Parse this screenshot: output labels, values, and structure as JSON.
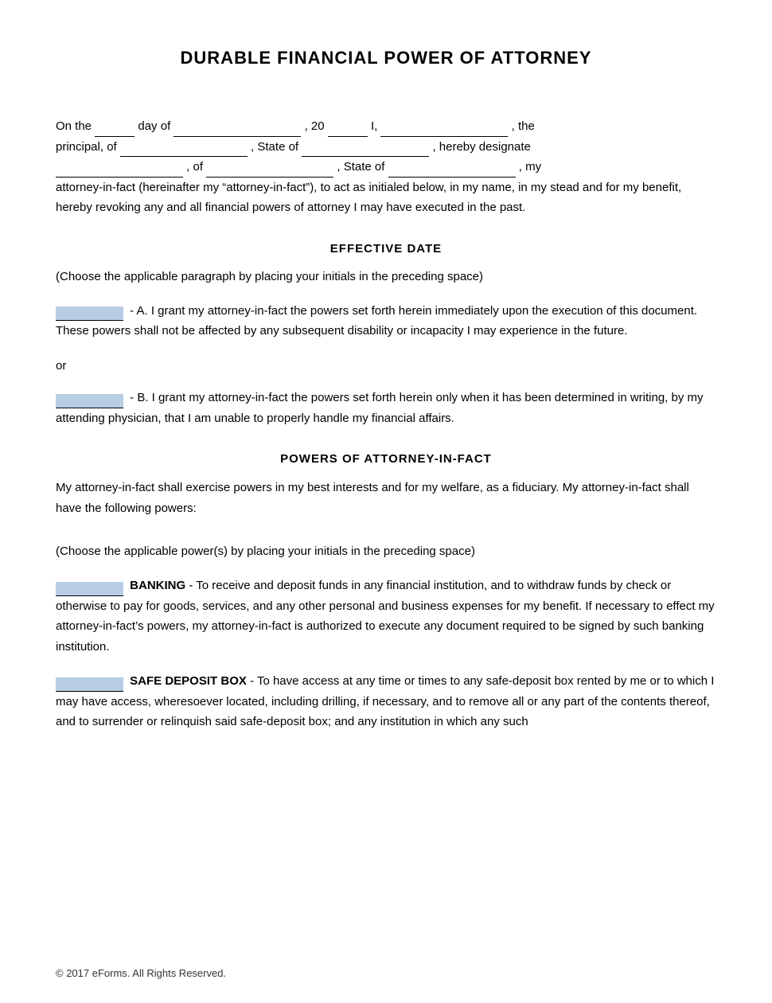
{
  "document": {
    "title": "DURABLE FINANCIAL POWER OF ATTORNEY",
    "intro": {
      "line1_prefix": "On the",
      "day_field": "",
      "of_day": "day of",
      "date_field": "",
      "year_prefix": ", 20",
      "year_field": "",
      "i_text": "I,",
      "principal_name_field": "",
      "the_principal": ", the",
      "principal_of": "principal, of",
      "principal_address_field": "",
      "state_of1": ", State of",
      "state1_field": "",
      "hereby_designate": ", hereby designate",
      "designee_field": "",
      "of_text": ", of",
      "designee_address_field": "",
      "state_of2": ", State of",
      "state2_field": "",
      "my_text": ", my",
      "paragraph2": "attorney-in-fact (hereinafter my “attorney-in-fact”), to act as initialed below, in my name, in my stead and for my benefit, hereby revoking any and all financial powers of attorney I may have executed in the past."
    },
    "effective_date": {
      "header": "EFFECTIVE DATE",
      "choose_note": "(Choose the applicable paragraph by placing your initials in the preceding space)",
      "option_a": "- A. I grant my attorney-in-fact the powers set forth herein immediately upon the execution of this document. These powers shall not be affected by any subsequent disability or incapacity I may experience in the future.",
      "or_text": "or",
      "option_b": "- B. I grant my attorney-in-fact the powers set forth herein only when it has been determined in writing, by my attending physician, that I am unable to properly handle my financial affairs."
    },
    "powers_section": {
      "header": "POWERS OF ATTORNEY-IN-FACT",
      "intro_text": "My attorney-in-fact shall exercise powers in my best interests and for my welfare, as a fiduciary. My attorney-in-fact shall have the following powers:",
      "choose_note": "(Choose the applicable power(s) by placing your initials in the preceding space)",
      "banking": {
        "label": "BANKING",
        "text": "- To receive and deposit funds in any financial institution, and to withdraw funds by check or otherwise to pay for goods, services, and any other personal and business expenses for my benefit.  If necessary to effect my attorney-in-fact’s powers, my attorney-in-fact is authorized to execute any document required to be signed by such banking institution."
      },
      "safe_deposit": {
        "label": "SAFE DEPOSIT BOX",
        "text": "- To have access at any time or times to any safe-deposit box rented by me or to which I may have access, wheresoever located, including drilling, if necessary, and to remove all or any part of the contents thereof, and to surrender or relinquish said safe-deposit box; and any institution in which any such"
      }
    },
    "footer": {
      "copyright": "© 2017 eForms. All Rights Reserved."
    }
  }
}
